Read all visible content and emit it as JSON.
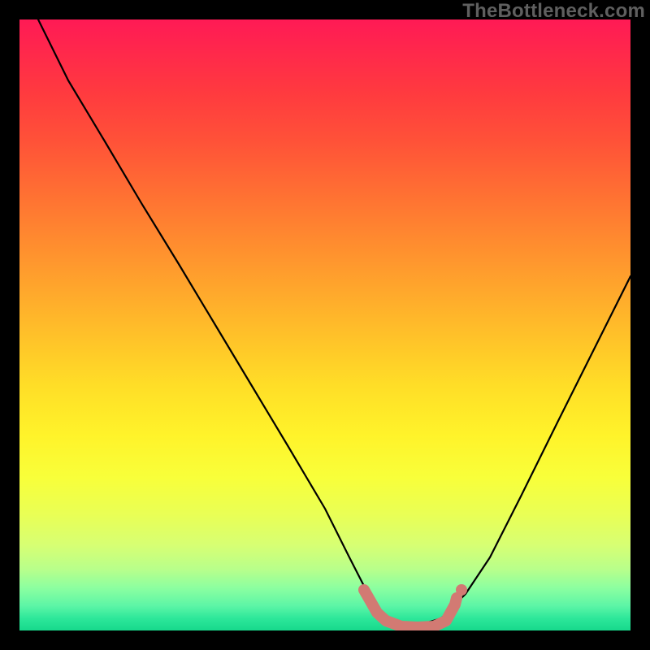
{
  "watermark": "TheBottleneck.com",
  "chart_data": {
    "type": "line",
    "title": "",
    "xlabel": "",
    "ylabel": "",
    "xlim": [
      0,
      100
    ],
    "ylim": [
      0,
      100
    ],
    "grid": false,
    "series": [
      {
        "name": "bottleneck-curve",
        "x": [
          3,
          8,
          14,
          20,
          26,
          32,
          38,
          44,
          50,
          54,
          57,
          60,
          63,
          66,
          69,
          73,
          77,
          82,
          88,
          94,
          100
        ],
        "y": [
          100,
          90,
          80,
          70,
          60,
          50,
          40,
          30,
          20,
          12,
          6,
          2,
          1,
          1,
          2,
          6,
          12,
          22,
          34,
          46,
          58
        ]
      },
      {
        "name": "highlight-band",
        "x": [
          57,
          60,
          63,
          66,
          69,
          71
        ],
        "y": [
          6,
          2,
          1,
          1,
          2,
          5
        ]
      }
    ],
    "colors": {
      "curve": "#000000",
      "highlight": "#d27a73",
      "gradient_top": "#ff1a55",
      "gradient_mid": "#ffe42a",
      "gradient_bottom": "#17d98c"
    }
  }
}
